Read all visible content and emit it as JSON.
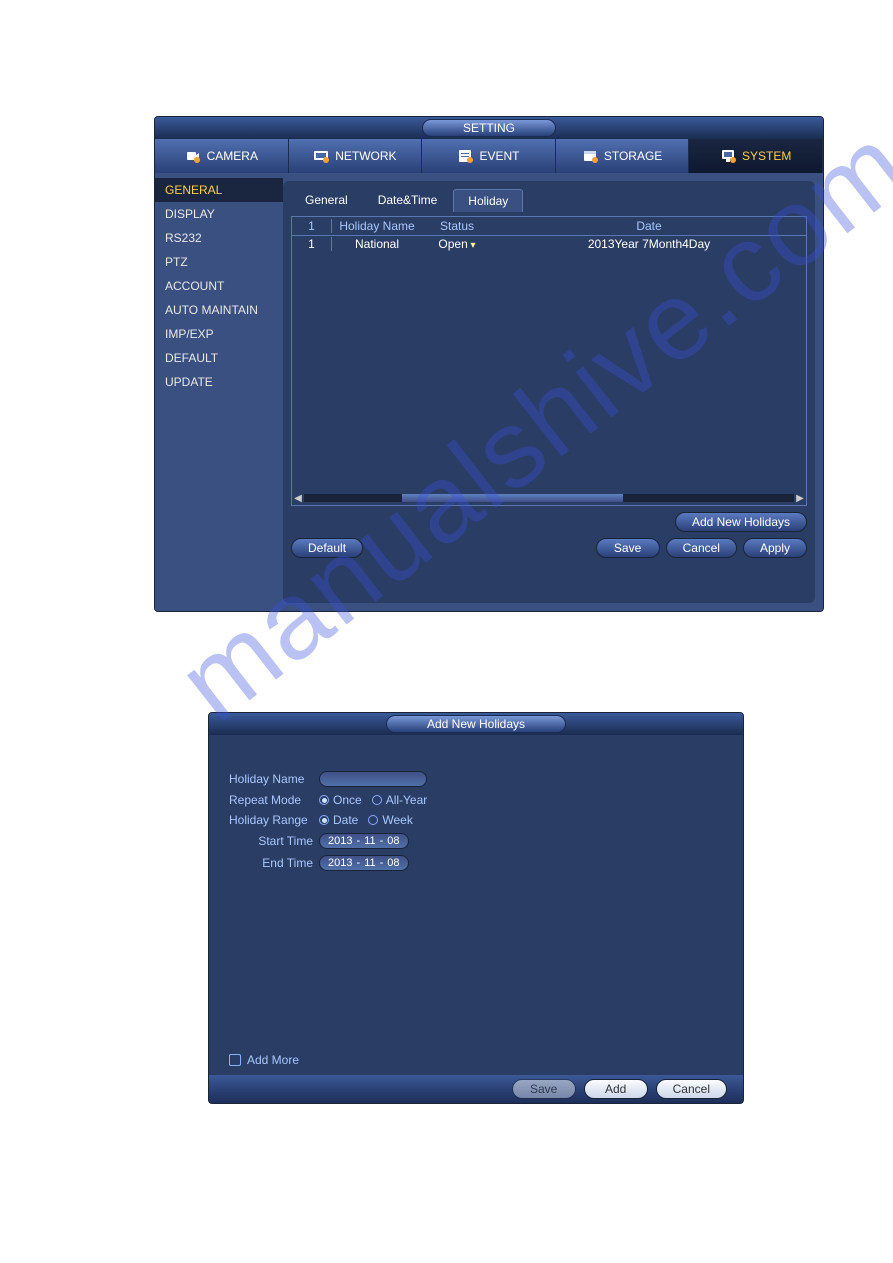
{
  "watermark": "manualshive.com",
  "win1": {
    "title": "SETTING",
    "topnav": [
      {
        "label": "CAMERA"
      },
      {
        "label": "NETWORK"
      },
      {
        "label": "EVENT"
      },
      {
        "label": "STORAGE"
      },
      {
        "label": "SYSTEM"
      }
    ],
    "topnav_active": 4,
    "sidebar": [
      "GENERAL",
      "DISPLAY",
      "RS232",
      "PTZ",
      "ACCOUNT",
      "AUTO MAINTAIN",
      "IMP/EXP",
      "DEFAULT",
      "UPDATE"
    ],
    "sidebar_active": 0,
    "subtabs": [
      "General",
      "Date&Time",
      "Holiday"
    ],
    "subtab_active": 2,
    "table": {
      "headers": {
        "idx": "1",
        "name": "Holiday Name",
        "status": "Status",
        "date": "Date"
      },
      "rows": [
        {
          "idx": "1",
          "name": "National",
          "status": "Open",
          "date": "2013Year 7Month4Day"
        }
      ]
    },
    "buttons": {
      "add_new": "Add New Holidays",
      "default": "Default",
      "save": "Save",
      "cancel": "Cancel",
      "apply": "Apply"
    }
  },
  "win2": {
    "title": "Add New Holidays",
    "fields": {
      "holiday_name_label": "Holiday Name",
      "repeat_mode_label": "Repeat Mode",
      "repeat_options": [
        "Once",
        "All-Year"
      ],
      "repeat_selected": 0,
      "holiday_range_label": "Holiday Range",
      "range_options": [
        "Date",
        "Week"
      ],
      "range_selected": 0,
      "start_time_label": "Start Time",
      "start_time": {
        "y": "2013",
        "m": "11",
        "d": "08"
      },
      "end_time_label": "End Time",
      "end_time": {
        "y": "2013",
        "m": "11",
        "d": "08"
      }
    },
    "add_more": "Add More",
    "buttons": {
      "save": "Save",
      "add": "Add",
      "cancel": "Cancel"
    }
  }
}
